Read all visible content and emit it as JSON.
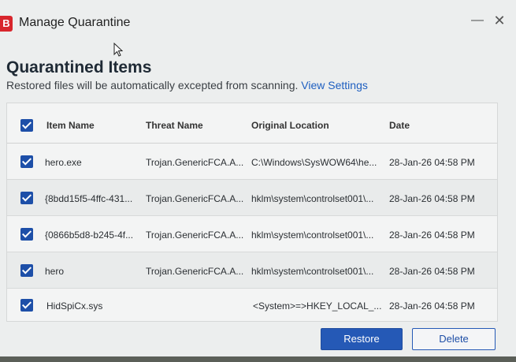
{
  "window": {
    "app_icon_letter": "B",
    "title": "Manage Quarantine",
    "minimize_glyph": "—",
    "close_glyph": "✕"
  },
  "page": {
    "heading": "Quarantined Items",
    "subtitle": "Restored files will be automatically excepted from scanning.",
    "view_settings_link": "View Settings"
  },
  "table": {
    "columns": [
      "Item Name",
      "Threat Name",
      "Original Location",
      "Date"
    ],
    "select_all_checked": true,
    "rows": [
      {
        "checked": true,
        "item": "hero.exe",
        "threat": "Trojan.GenericFCA.A...",
        "location": "C:\\Windows\\SysWOW64\\he...",
        "date": "28-Jan-26 04:58 PM"
      },
      {
        "checked": true,
        "item": "{8bdd15f5-4ffc-431...",
        "threat": "Trojan.GenericFCA.A...",
        "location": "hklm\\system\\controlset001\\...",
        "date": "28-Jan-26 04:58 PM"
      },
      {
        "checked": true,
        "item": "{0866b5d8-b245-4f...",
        "threat": "Trojan.GenericFCA.A...",
        "location": "hklm\\system\\controlset001\\...",
        "date": "28-Jan-26 04:58 PM"
      },
      {
        "checked": true,
        "item": "hero",
        "threat": "Trojan.GenericFCA.A...",
        "location": "hklm\\system\\controlset001\\...",
        "date": "28-Jan-26 04:58 PM"
      },
      {
        "checked": true,
        "item": "HidSpiCx.sys",
        "threat": "",
        "location": "<System>=>HKEY_LOCAL_...",
        "date": "28-Jan-26 04:58 PM"
      }
    ]
  },
  "buttons": {
    "restore": "Restore",
    "delete": "Delete"
  },
  "colors": {
    "accent": "#2559b6",
    "link": "#1e5fc0",
    "brand_red": "#d8262d"
  },
  "icons": {
    "app": "bitdefender-logo-icon",
    "minimize": "minimize-icon",
    "close": "close-icon",
    "cursor": "mouse-pointer-icon",
    "checkbox": "checkbox-checked-icon"
  }
}
